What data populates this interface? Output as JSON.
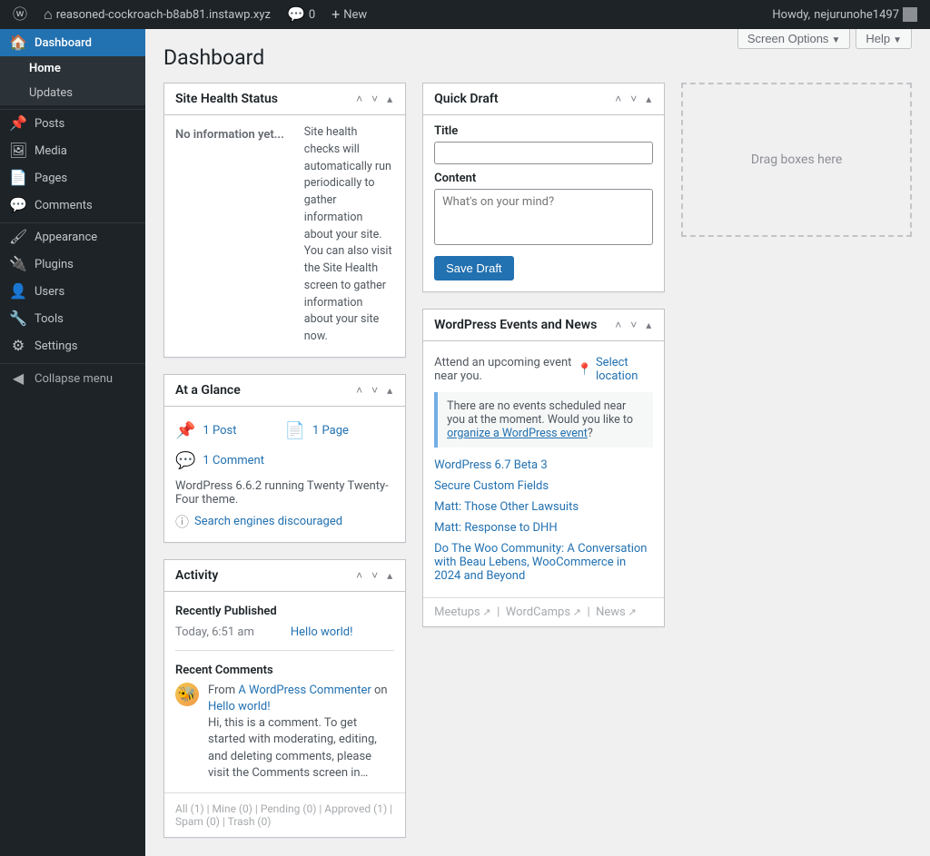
{
  "adminbar": {
    "site_name": "reasoned-cockroach-b8ab81.instawp.xyz",
    "comments_count": "0",
    "new_label": "New",
    "howdy_prefix": "Howdy, ",
    "username": "nejurunohe1497"
  },
  "sidebar": {
    "items": [
      {
        "label": "Dashboard"
      },
      {
        "label": "Posts"
      },
      {
        "label": "Media"
      },
      {
        "label": "Pages"
      },
      {
        "label": "Comments"
      },
      {
        "label": "Appearance"
      },
      {
        "label": "Plugins"
      },
      {
        "label": "Users"
      },
      {
        "label": "Tools"
      },
      {
        "label": "Settings"
      }
    ],
    "submenu": [
      {
        "label": "Home"
      },
      {
        "label": "Updates"
      }
    ],
    "collapse_label": "Collapse menu"
  },
  "screen": {
    "options_label": "Screen Options",
    "help_label": "Help"
  },
  "page_title": "Dashboard",
  "site_health": {
    "title": "Site Health Status",
    "left": "No information yet...",
    "right": "Site health checks will automatically run periodically to gather information about your site. You can also visit the Site Health screen to gather information about your site now."
  },
  "glance": {
    "title": "At a Glance",
    "posts": "1 Post",
    "pages": "1 Page",
    "comments": "1 Comment",
    "version_line": "WordPress 6.6.2 running Twenty Twenty-Four theme.",
    "search_disc": "Search engines discouraged"
  },
  "activity": {
    "title": "Activity",
    "recent_pub_head": "Recently Published",
    "recent_time": "Today, 6:51 am",
    "recent_title": "Hello world!",
    "recent_comments_head": "Recent Comments",
    "comment_byline_from": "From ",
    "comment_byline_author": "A WordPress Commenter",
    "comment_byline_on": " on ",
    "comment_byline_post": "Hello world!",
    "comment_body": "Hi, this is a comment. To get started with moderating, editing, and deleting comments, please visit the Comments screen in…",
    "subsub": "All (1)  |  Mine (0)  |  Pending (0)  |  Approved (1)  |  Spam (0)  |  Trash (0)"
  },
  "quickdraft": {
    "title": "Quick Draft",
    "title_label": "Title",
    "content_label": "Content",
    "content_placeholder": "What's on your mind?",
    "save_label": "Save Draft"
  },
  "events": {
    "title": "WordPress Events and News",
    "attend_line": "Attend an upcoming event near you.",
    "select_location": "Select location",
    "no_events_pre": "There are no events scheduled near you at the moment. Would you like to ",
    "no_events_link": "organize a WordPress event",
    "no_events_post": "?",
    "news": [
      "WordPress 6.7 Beta 3",
      "Secure Custom Fields",
      "Matt: Those Other Lawsuits",
      "Matt: Response to DHH",
      "Do The Woo Community: A Conversation with Beau Lebens, WooCommerce in 2024 and Beyond"
    ],
    "footer_meetups": "Meetups",
    "footer_wordcamps": "WordCamps",
    "footer_news": "News"
  },
  "dropzone_label": "Drag boxes here"
}
